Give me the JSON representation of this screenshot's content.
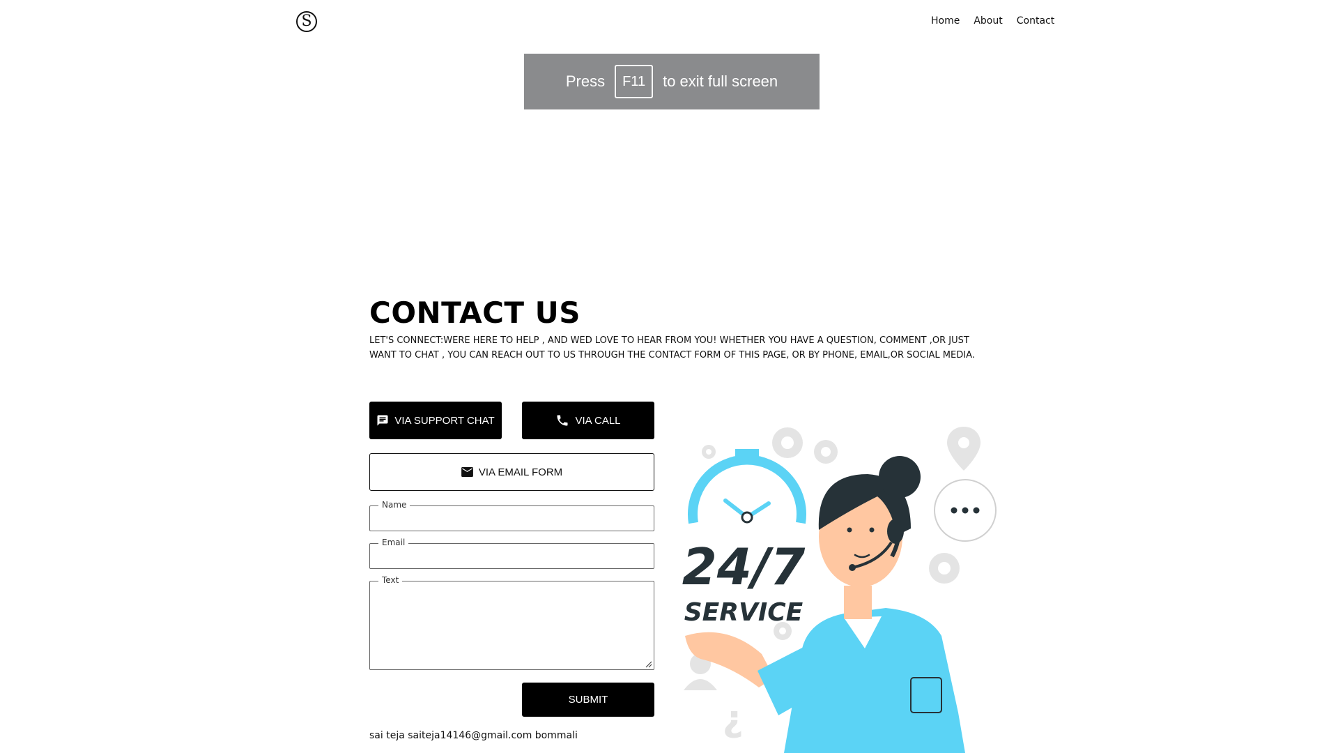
{
  "header": {
    "logo_letter": "S",
    "nav": [
      {
        "label": "Home"
      },
      {
        "label": "About"
      },
      {
        "label": "Contact"
      }
    ]
  },
  "fullscreen_toast": {
    "prefix": "Press",
    "key": "F11",
    "suffix": "to exit full screen"
  },
  "contact": {
    "title": "CONTACT US",
    "description": "LET'S CONNECT:WERE HERE TO HELP , AND WED LOVE TO HEAR FROM YOU! WHETHER YOU HAVE A QUESTION, COMMENT ,OR JUST WANT TO CHAT , YOU CAN REACH OUT TO US THROUGH THE CONTACT FORM OF THIS PAGE, OR BY PHONE, EMAIL,OR SOCIAL MEDIA.",
    "buttons": {
      "chat": "VIA SUPPORT CHAT",
      "call": "VIA CALL",
      "email": "VIA EMAIL FORM",
      "submit": "SUBMIT"
    },
    "form": {
      "name_label": "Name",
      "name_value": "",
      "email_label": "Email",
      "email_value": "",
      "text_label": "Text",
      "text_value": ""
    },
    "footer": "sai teja saiteja14146@gmail.com bommali"
  },
  "illustration": {
    "headline": "24/7",
    "subheadline": "SERVICE"
  },
  "colors": {
    "accent_blue": "#5bd3f5",
    "toast_bg": "#8a8b8d",
    "button_dark": "#000000",
    "hair": "#263238",
    "skin": "#ffc7a1"
  }
}
